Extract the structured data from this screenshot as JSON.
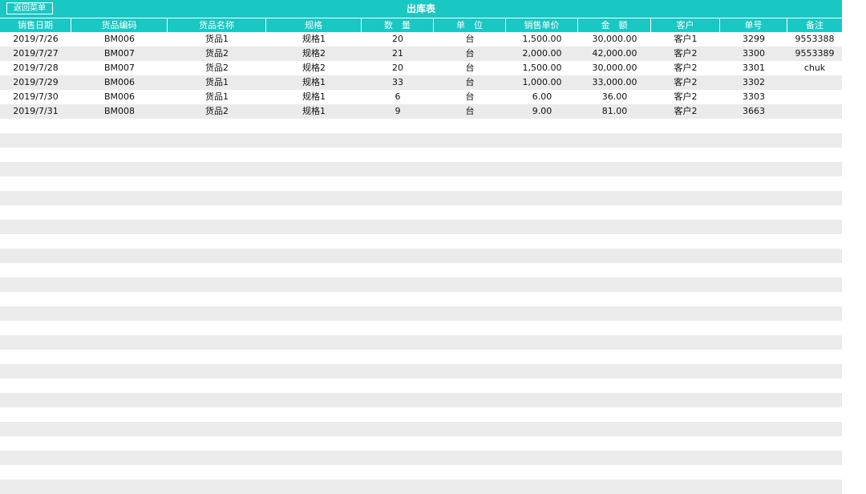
{
  "title": "出库表",
  "back_button": "返回菜单",
  "columns": [
    "销售日期",
    "货品编码",
    "货品名称",
    "规格",
    "数　量",
    "单　位",
    "销售单价",
    "金　额",
    "客户",
    "单号",
    "备注"
  ],
  "rows": [
    [
      "2019/7/26",
      "BM006",
      "货品1",
      "规格1",
      "20",
      "台",
      "1,500.00",
      "30,000.00",
      "客户1",
      "3299",
      "9553388"
    ],
    [
      "2019/7/27",
      "BM007",
      "货品2",
      "规格2",
      "21",
      "台",
      "2,000.00",
      "42,000.00",
      "客户2",
      "3300",
      "9553389"
    ],
    [
      "2019/7/28",
      "BM007",
      "货品2",
      "规格2",
      "20",
      "台",
      "1,500.00",
      "30,000.00",
      "客户2",
      "3301",
      "chuk"
    ],
    [
      "2019/7/29",
      "BM006",
      "货品1",
      "规格1",
      "33",
      "台",
      "1,000.00",
      "33,000.00",
      "客户2",
      "3302",
      ""
    ],
    [
      "2019/7/30",
      "BM006",
      "货品1",
      "规格1",
      "6",
      "台",
      "6.00",
      "36.00",
      "客户2",
      "3303",
      ""
    ],
    [
      "2019/7/31",
      "BM008",
      "货品2",
      "规格1",
      "9",
      "台",
      "9.00",
      "81.00",
      "客户2",
      "3663",
      ""
    ]
  ],
  "colors": {
    "header": "#19c7c3",
    "stripe": "#ebebeb"
  }
}
